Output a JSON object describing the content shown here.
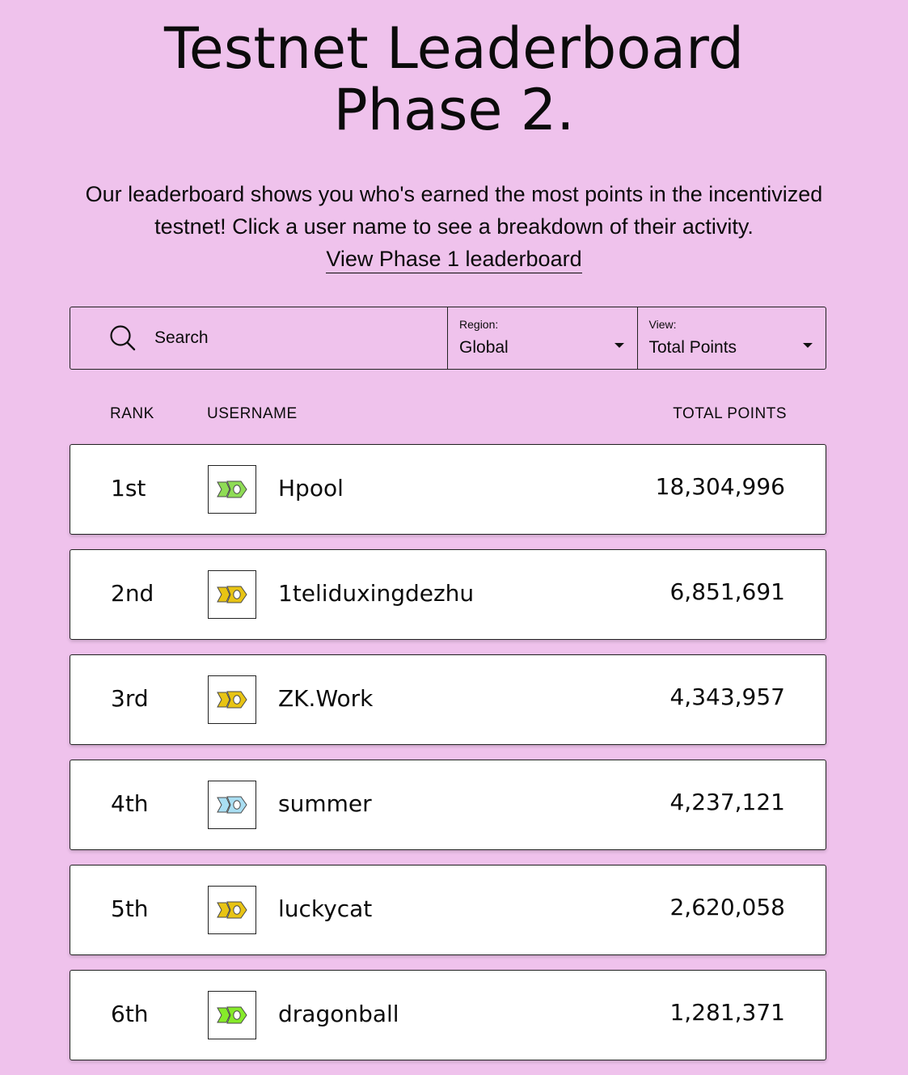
{
  "header": {
    "title_line1": "Testnet Leaderboard",
    "title_line2": "Phase 2."
  },
  "intro": {
    "line1": "Our leaderboard shows you who's earned the most points in the incentivized",
    "line2": "testnet! Click a user name to see a breakdown of their activity.",
    "phase1_link": "View Phase 1 leaderboard"
  },
  "filters": {
    "search_placeholder": "Search",
    "region_label": "Region:",
    "region_value": "Global",
    "view_label": "View:",
    "view_value": "Total Points"
  },
  "table": {
    "headers": {
      "rank": "RANK",
      "username": "USERNAME",
      "points": "TOTAL POINTS"
    },
    "rows": [
      {
        "rank": "1st",
        "username": "Hpool",
        "points": "18,304,996",
        "avatar_color": "#8fdc55"
      },
      {
        "rank": "2nd",
        "username": "1teliduxingdezhu",
        "points": "6,851,691",
        "avatar_color": "#e8c414"
      },
      {
        "rank": "3rd",
        "username": "ZK.Work",
        "points": "4,343,957",
        "avatar_color": "#e8c414"
      },
      {
        "rank": "4th",
        "username": "summer",
        "points": "4,237,121",
        "avatar_color": "#a9def2"
      },
      {
        "rank": "5th",
        "username": "luckycat",
        "points": "2,620,058",
        "avatar_color": "#e8c414"
      },
      {
        "rank": "6th",
        "username": "dragonball",
        "points": "1,281,371",
        "avatar_color": "#86ea2a"
      }
    ]
  },
  "theme": {
    "background": "#efc2ec",
    "card": "#ffffff",
    "text": "#0b0b0b"
  },
  "icons": {
    "search": "search-icon",
    "dropdown": "caret-down-icon",
    "avatar": "hex-logo-icon"
  }
}
